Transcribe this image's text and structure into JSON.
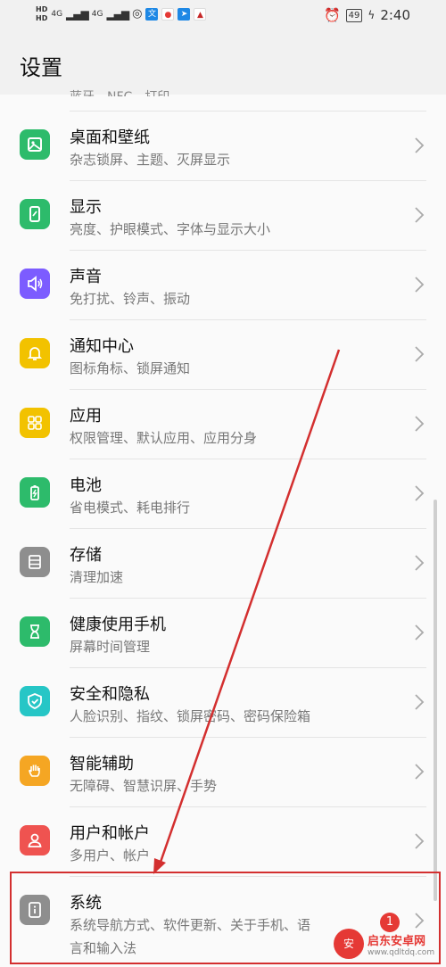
{
  "status": {
    "hd1": "HD",
    "hd2": "HD",
    "net1": "4G",
    "net2": "4G",
    "battery": "49",
    "time": "2:40"
  },
  "header": {
    "title": "设置"
  },
  "scrolled_stub": "蓝牙、NFC、打印",
  "items": [
    {
      "title": "桌面和壁纸",
      "subtitle": "杂志锁屏、主题、灭屏显示",
      "icon": "wallpaper-icon",
      "color": "#2dbb6b"
    },
    {
      "title": "显示",
      "subtitle": "亮度、护眼模式、字体与显示大小",
      "icon": "display-icon",
      "color": "#2dbb6b"
    },
    {
      "title": "声音",
      "subtitle": "免打扰、铃声、振动",
      "icon": "sound-icon",
      "color": "#7c5cff"
    },
    {
      "title": "通知中心",
      "subtitle": "图标角标、锁屏通知",
      "icon": "bell-icon",
      "color": "#f2c200"
    },
    {
      "title": "应用",
      "subtitle": "权限管理、默认应用、应用分身",
      "icon": "apps-grid-icon",
      "color": "#f2c200"
    },
    {
      "title": "电池",
      "subtitle": "省电模式、耗电排行",
      "icon": "battery-icon",
      "color": "#2dbb6b"
    },
    {
      "title": "存储",
      "subtitle": "清理加速",
      "icon": "storage-icon",
      "color": "#8e8e8e"
    },
    {
      "title": "健康使用手机",
      "subtitle": "屏幕时间管理",
      "icon": "hourglass-icon",
      "color": "#2dbb6b"
    },
    {
      "title": "安全和隐私",
      "subtitle": "人脸识别、指纹、锁屏密码、密码保险箱",
      "icon": "shield-icon",
      "color": "#26c6c6"
    },
    {
      "title": "智能辅助",
      "subtitle": "无障碍、智慧识屏、手势",
      "icon": "hand-icon",
      "color": "#f5a623"
    },
    {
      "title": "用户和帐户",
      "subtitle": "多用户、帐户",
      "icon": "user-icon",
      "color": "#ef5350"
    },
    {
      "title": "系统",
      "subtitle": "系统导航方式、软件更新、关于手机、语",
      "subtitle2": "言和输入法",
      "icon": "system-info-icon",
      "color": "#8e8e8e",
      "badge": "1"
    }
  ],
  "watermark": {
    "brand": "启东安卓网",
    "url": "www.qdltdq.com"
  }
}
